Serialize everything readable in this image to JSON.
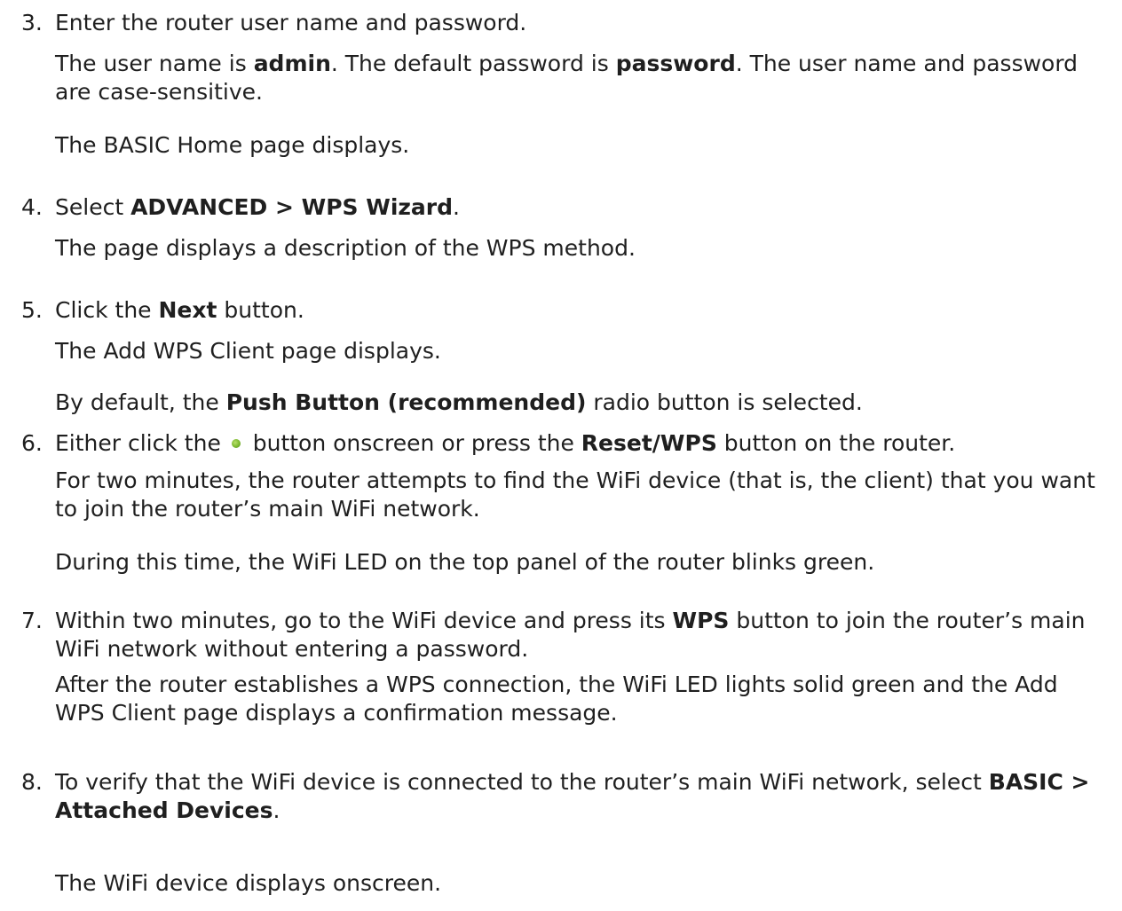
{
  "steps": [
    {
      "num": "3.",
      "instruction": "Enter the router user name and password.",
      "notes": [
        {
          "a": "The user name is ",
          "b1": "admin",
          "c": ". The default password is ",
          "b2": "password",
          "d": ". The user name and password are case-sensitive."
        },
        {
          "text": "The BASIC Home page displays."
        }
      ]
    },
    {
      "num": "4.",
      "instruction_pre": "Select ",
      "instruction_bold": "ADVANCED > WPS Wizard",
      "instruction_post": ".",
      "notes": [
        {
          "text": "The page displays a description of the WPS method."
        }
      ]
    },
    {
      "num": "5.",
      "instruction_pre": "Click the ",
      "instruction_bold": "Next",
      "instruction_post": " button.",
      "notes": [
        {
          "text": "The Add WPS Client page displays."
        },
        {
          "pre": "By default, the ",
          "bold": "Push Button (recommended)",
          "post": " radio button is selected."
        }
      ]
    },
    {
      "num": "6.",
      "instruction_pre": "Either click the ",
      "instruction_mid": " button onscreen or press the ",
      "instruction_bold": "Reset/WPS",
      "instruction_post": " button on the router.",
      "notes": [
        {
          "text": "For two minutes, the router attempts to find the WiFi device (that is, the client) that you want to join the router’s main WiFi network."
        },
        {
          "text": "During this time, the WiFi LED on the top panel of the router blinks green."
        }
      ]
    },
    {
      "num": "7.",
      "instruction_pre": "Within two minutes, go to the WiFi device and press its ",
      "instruction_bold": "WPS",
      "instruction_post": " button to join the router’s main WiFi network without entering a password.",
      "notes": [
        {
          "text": "After the router establishes a WPS connection, the WiFi LED lights solid green and the Add WPS Client page displays a confirmation message."
        }
      ]
    },
    {
      "num": "8.",
      "instruction_pre": "To verify that the WiFi device is connected to the router’s main WiFi network, select ",
      "instruction_bold": "BASIC > Attached Devices",
      "instruction_post": ".",
      "notes": [
        {
          "text": "The WiFi device displays onscreen."
        }
      ]
    }
  ],
  "icons": {
    "wps_button": "wps-push-button-icon"
  },
  "colors": {
    "text": "#1f1f1f",
    "wps_green": "#7cb82f"
  }
}
